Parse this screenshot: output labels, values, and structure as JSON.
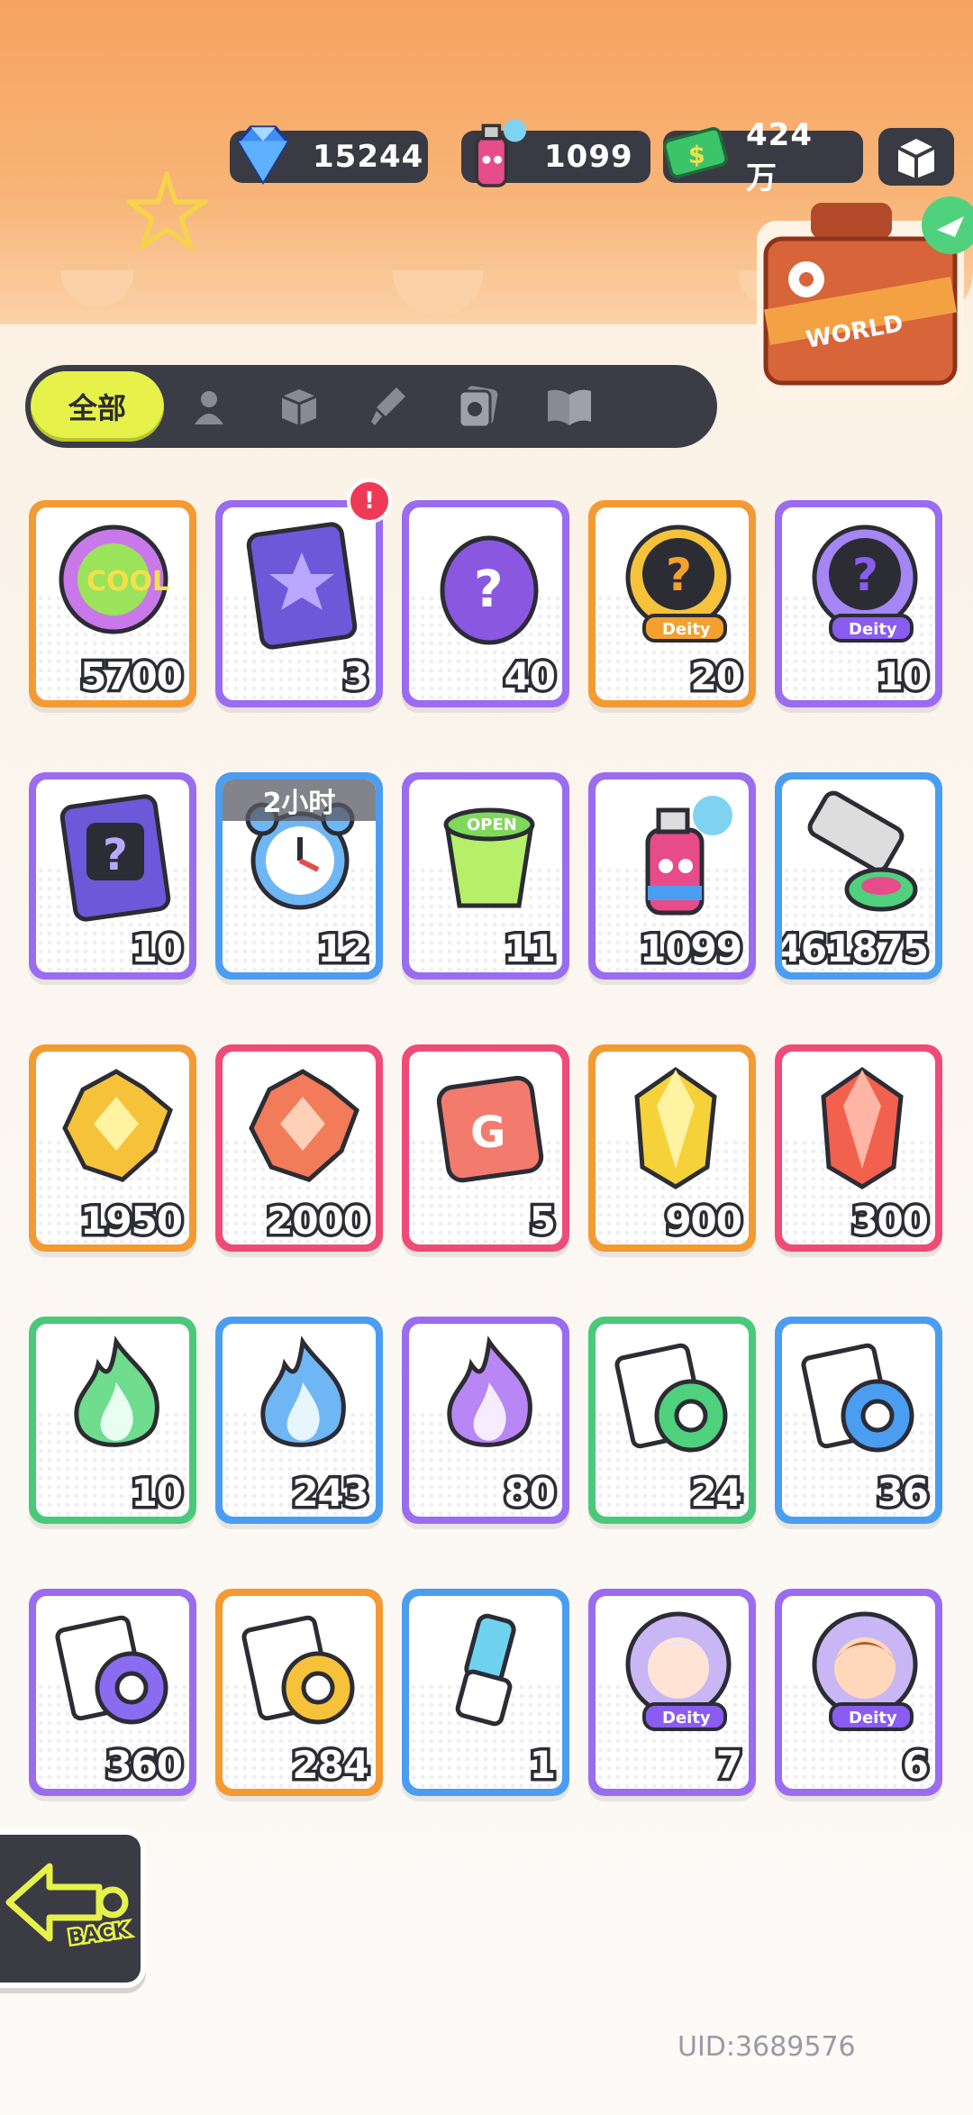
{
  "currencies": [
    {
      "name": "gem-icon",
      "value": "15244"
    },
    {
      "name": "spray-can-icon",
      "value": "1099"
    },
    {
      "name": "money-icon",
      "value": "424万"
    }
  ],
  "tabs": {
    "all_label": "全部",
    "icons": [
      "person-icon",
      "box-icon",
      "brush-icon",
      "photo-icon",
      "book-icon"
    ]
  },
  "items": [
    {
      "icon": "cool-badge-icon",
      "count": "5700",
      "color": "#f39a32"
    },
    {
      "icon": "travel-card-star-icon",
      "count": "3",
      "color": "#9a6cf0",
      "badge": "!"
    },
    {
      "icon": "mystery-egg-icon",
      "count": "40",
      "color": "#9a6cf0"
    },
    {
      "icon": "deity-mystery-gold-icon",
      "count": "20",
      "color": "#f39a32"
    },
    {
      "icon": "deity-mystery-purple-icon",
      "count": "10",
      "color": "#9a6cf0"
    },
    {
      "icon": "travel-card-mystery-icon",
      "count": "10",
      "color": "#9a6cf0"
    },
    {
      "icon": "alarm-clock-icon",
      "count": "12",
      "color": "#4b9df0",
      "timer": "2小时"
    },
    {
      "icon": "green-cup-icon",
      "count": "11",
      "color": "#9a6cf0"
    },
    {
      "icon": "spray-can-icon",
      "count": "1099",
      "color": "#9a6cf0"
    },
    {
      "icon": "paint-tube-icon",
      "count": "461875",
      "color": "#4b9df0"
    },
    {
      "icon": "gold-crystal-icon",
      "count": "1950",
      "color": "#f39a32"
    },
    {
      "icon": "red-crystal-icon",
      "count": "2000",
      "color": "#ee4c78"
    },
    {
      "icon": "red-dice-icon",
      "count": "5",
      "color": "#ee4c78"
    },
    {
      "icon": "gold-gem-icon",
      "count": "900",
      "color": "#f39a32"
    },
    {
      "icon": "red-gem-icon",
      "count": "300",
      "color": "#ee4c78"
    },
    {
      "icon": "green-flame-icon",
      "count": "10",
      "color": "#49c97a"
    },
    {
      "icon": "blue-flame-icon",
      "count": "243",
      "color": "#4b9df0"
    },
    {
      "icon": "purple-flame-icon",
      "count": "80",
      "color": "#9a6cf0"
    },
    {
      "icon": "green-tape-icon",
      "count": "24",
      "color": "#49c97a"
    },
    {
      "icon": "blue-tape-icon",
      "count": "36",
      "color": "#4b9df0"
    },
    {
      "icon": "purple-tape-icon",
      "count": "360",
      "color": "#9a6cf0"
    },
    {
      "icon": "gold-tape-icon",
      "count": "284",
      "color": "#f39a32"
    },
    {
      "icon": "usb-key-icon",
      "count": "1",
      "color": "#4b9df0"
    },
    {
      "icon": "deity-girl-portrait-icon",
      "count": "7",
      "color": "#9a6cf0"
    },
    {
      "icon": "deity-boy-portrait-icon",
      "count": "6",
      "color": "#9a6cf0"
    }
  ],
  "back_label": "BACK",
  "uid": "UID:3689576"
}
